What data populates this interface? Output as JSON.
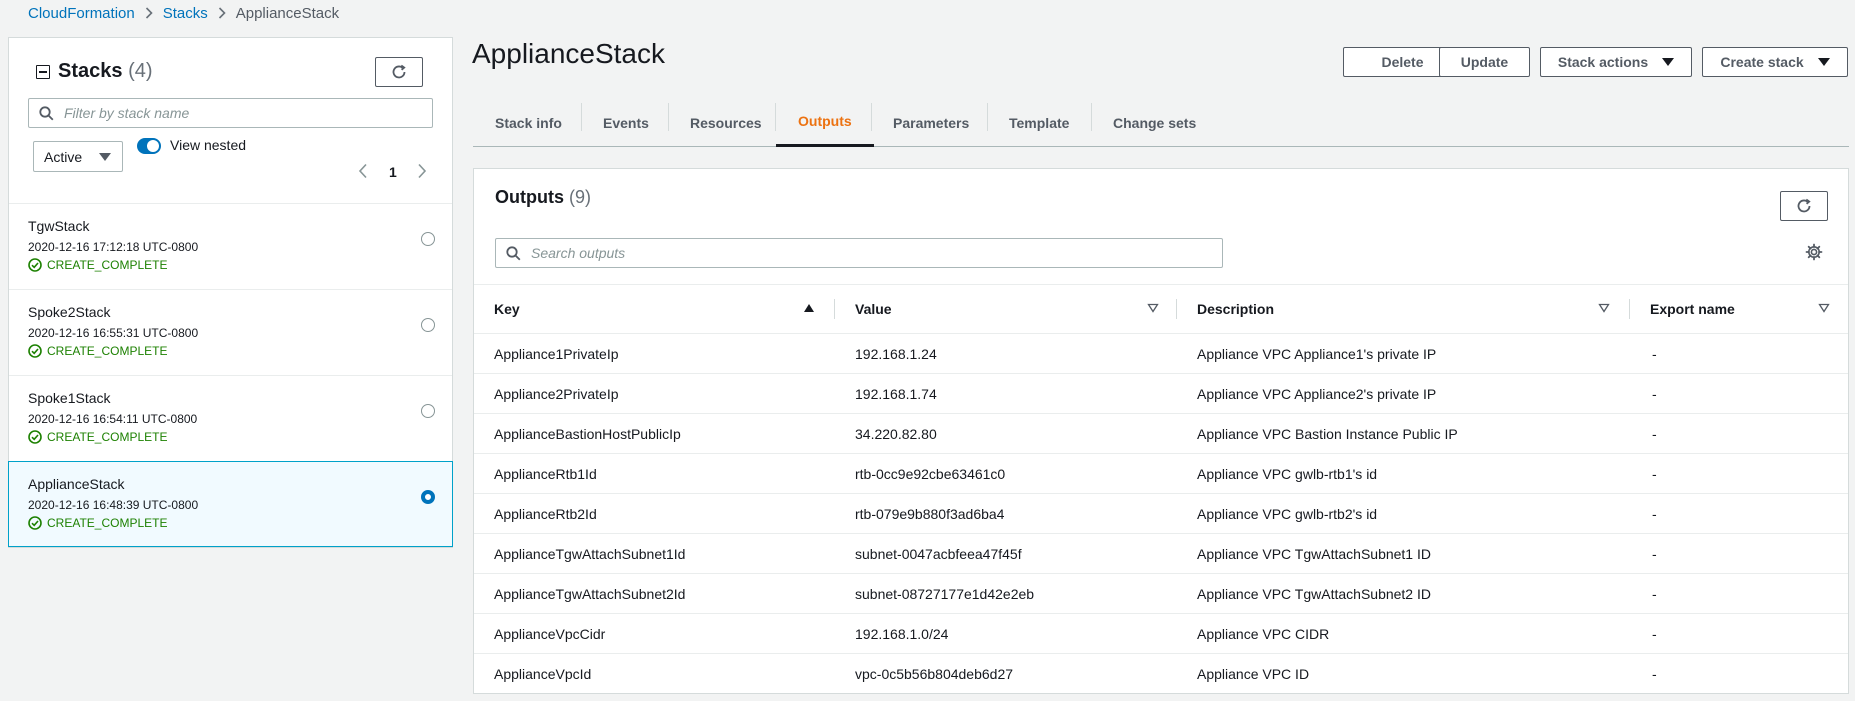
{
  "breadcrumb": {
    "items": [
      "CloudFormation",
      "Stacks"
    ],
    "current": "ApplianceStack"
  },
  "stacks_panel": {
    "title": "Stacks",
    "count": "(4)",
    "filter_placeholder": "Filter by stack name",
    "status_filter": "Active",
    "view_nested_label": "View nested",
    "view_nested_on": true,
    "page": "1",
    "stacks": [
      {
        "name": "TgwStack",
        "date": "2020-12-16 17:12:18 UTC-0800",
        "status": "CREATE_COMPLETE",
        "selected": false
      },
      {
        "name": "Spoke2Stack",
        "date": "2020-12-16 16:55:31 UTC-0800",
        "status": "CREATE_COMPLETE",
        "selected": false
      },
      {
        "name": "Spoke1Stack",
        "date": "2020-12-16 16:54:11 UTC-0800",
        "status": "CREATE_COMPLETE",
        "selected": false
      },
      {
        "name": "ApplianceStack",
        "date": "2020-12-16 16:48:39 UTC-0800",
        "status": "CREATE_COMPLETE",
        "selected": true
      }
    ]
  },
  "header": {
    "title": "ApplianceStack",
    "buttons": {
      "delete": "Delete",
      "update": "Update",
      "stack_actions": "Stack actions",
      "create_stack": "Create stack"
    }
  },
  "tabs": [
    {
      "label": "Stack info",
      "active": false
    },
    {
      "label": "Events",
      "active": false
    },
    {
      "label": "Resources",
      "active": false
    },
    {
      "label": "Outputs",
      "active": true
    },
    {
      "label": "Parameters",
      "active": false
    },
    {
      "label": "Template",
      "active": false
    },
    {
      "label": "Change sets",
      "active": false
    }
  ],
  "outputs": {
    "title": "Outputs",
    "count": "(9)",
    "search_placeholder": "Search outputs",
    "columns": [
      "Key",
      "Value",
      "Description",
      "Export name"
    ],
    "rows": [
      [
        "Appliance1PrivateIp",
        "192.168.1.24",
        "Appliance VPC Appliance1's private IP",
        "-"
      ],
      [
        "Appliance2PrivateIp",
        "192.168.1.74",
        "Appliance VPC Appliance2's private IP",
        "-"
      ],
      [
        "ApplianceBastionHostPublicIp",
        "34.220.82.80",
        "Appliance VPC Bastion Instance Public IP",
        "-"
      ],
      [
        "ApplianceRtb1Id",
        "rtb-0cc9e92cbe63461c0",
        "Appliance VPC gwlb-rtb1's id",
        "-"
      ],
      [
        "ApplianceRtb2Id",
        "rtb-079e9b880f3ad6ba4",
        "Appliance VPC gwlb-rtb2's id",
        "-"
      ],
      [
        "ApplianceTgwAttachSubnet1Id",
        "subnet-0047acbfeea47f45f",
        "Appliance VPC TgwAttachSubnet1 ID",
        "-"
      ],
      [
        "ApplianceTgwAttachSubnet2Id",
        "subnet-08727177e1d42e2eb",
        "Appliance VPC TgwAttachSubnet2 ID",
        "-"
      ],
      [
        "ApplianceVpcCidr",
        "192.168.1.0/24",
        "Appliance VPC CIDR",
        "-"
      ],
      [
        "ApplianceVpcId",
        "vpc-0c5b56b804deb6d27",
        "Appliance VPC ID",
        "-"
      ]
    ]
  },
  "colors": {
    "link": "#0073bb",
    "active_tab": "#ec7211",
    "success": "#1d8102",
    "selected_bg": "#f1faff"
  }
}
